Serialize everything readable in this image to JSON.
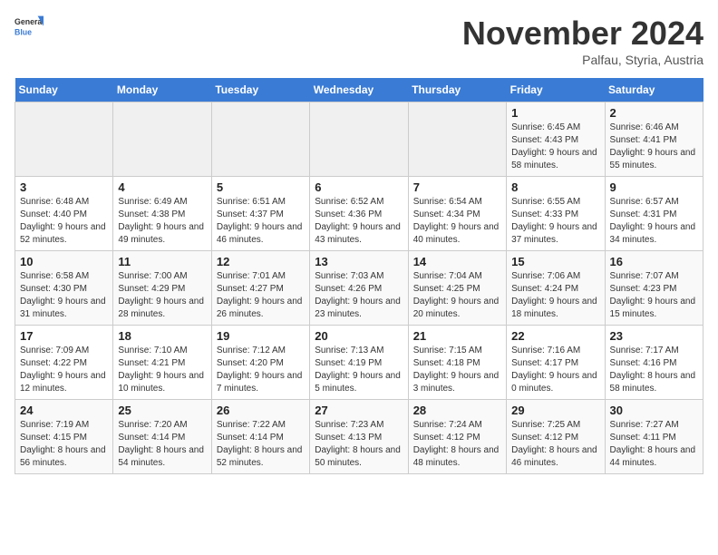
{
  "logo": {
    "line1": "General",
    "line2": "Blue"
  },
  "title": "November 2024",
  "subtitle": "Palfau, Styria, Austria",
  "days_of_week": [
    "Sunday",
    "Monday",
    "Tuesday",
    "Wednesday",
    "Thursday",
    "Friday",
    "Saturday"
  ],
  "weeks": [
    [
      {
        "day": "",
        "info": ""
      },
      {
        "day": "",
        "info": ""
      },
      {
        "day": "",
        "info": ""
      },
      {
        "day": "",
        "info": ""
      },
      {
        "day": "",
        "info": ""
      },
      {
        "day": "1",
        "info": "Sunrise: 6:45 AM\nSunset: 4:43 PM\nDaylight: 9 hours and 58 minutes."
      },
      {
        "day": "2",
        "info": "Sunrise: 6:46 AM\nSunset: 4:41 PM\nDaylight: 9 hours and 55 minutes."
      }
    ],
    [
      {
        "day": "3",
        "info": "Sunrise: 6:48 AM\nSunset: 4:40 PM\nDaylight: 9 hours and 52 minutes."
      },
      {
        "day": "4",
        "info": "Sunrise: 6:49 AM\nSunset: 4:38 PM\nDaylight: 9 hours and 49 minutes."
      },
      {
        "day": "5",
        "info": "Sunrise: 6:51 AM\nSunset: 4:37 PM\nDaylight: 9 hours and 46 minutes."
      },
      {
        "day": "6",
        "info": "Sunrise: 6:52 AM\nSunset: 4:36 PM\nDaylight: 9 hours and 43 minutes."
      },
      {
        "day": "7",
        "info": "Sunrise: 6:54 AM\nSunset: 4:34 PM\nDaylight: 9 hours and 40 minutes."
      },
      {
        "day": "8",
        "info": "Sunrise: 6:55 AM\nSunset: 4:33 PM\nDaylight: 9 hours and 37 minutes."
      },
      {
        "day": "9",
        "info": "Sunrise: 6:57 AM\nSunset: 4:31 PM\nDaylight: 9 hours and 34 minutes."
      }
    ],
    [
      {
        "day": "10",
        "info": "Sunrise: 6:58 AM\nSunset: 4:30 PM\nDaylight: 9 hours and 31 minutes."
      },
      {
        "day": "11",
        "info": "Sunrise: 7:00 AM\nSunset: 4:29 PM\nDaylight: 9 hours and 28 minutes."
      },
      {
        "day": "12",
        "info": "Sunrise: 7:01 AM\nSunset: 4:27 PM\nDaylight: 9 hours and 26 minutes."
      },
      {
        "day": "13",
        "info": "Sunrise: 7:03 AM\nSunset: 4:26 PM\nDaylight: 9 hours and 23 minutes."
      },
      {
        "day": "14",
        "info": "Sunrise: 7:04 AM\nSunset: 4:25 PM\nDaylight: 9 hours and 20 minutes."
      },
      {
        "day": "15",
        "info": "Sunrise: 7:06 AM\nSunset: 4:24 PM\nDaylight: 9 hours and 18 minutes."
      },
      {
        "day": "16",
        "info": "Sunrise: 7:07 AM\nSunset: 4:23 PM\nDaylight: 9 hours and 15 minutes."
      }
    ],
    [
      {
        "day": "17",
        "info": "Sunrise: 7:09 AM\nSunset: 4:22 PM\nDaylight: 9 hours and 12 minutes."
      },
      {
        "day": "18",
        "info": "Sunrise: 7:10 AM\nSunset: 4:21 PM\nDaylight: 9 hours and 10 minutes."
      },
      {
        "day": "19",
        "info": "Sunrise: 7:12 AM\nSunset: 4:20 PM\nDaylight: 9 hours and 7 minutes."
      },
      {
        "day": "20",
        "info": "Sunrise: 7:13 AM\nSunset: 4:19 PM\nDaylight: 9 hours and 5 minutes."
      },
      {
        "day": "21",
        "info": "Sunrise: 7:15 AM\nSunset: 4:18 PM\nDaylight: 9 hours and 3 minutes."
      },
      {
        "day": "22",
        "info": "Sunrise: 7:16 AM\nSunset: 4:17 PM\nDaylight: 9 hours and 0 minutes."
      },
      {
        "day": "23",
        "info": "Sunrise: 7:17 AM\nSunset: 4:16 PM\nDaylight: 8 hours and 58 minutes."
      }
    ],
    [
      {
        "day": "24",
        "info": "Sunrise: 7:19 AM\nSunset: 4:15 PM\nDaylight: 8 hours and 56 minutes."
      },
      {
        "day": "25",
        "info": "Sunrise: 7:20 AM\nSunset: 4:14 PM\nDaylight: 8 hours and 54 minutes."
      },
      {
        "day": "26",
        "info": "Sunrise: 7:22 AM\nSunset: 4:14 PM\nDaylight: 8 hours and 52 minutes."
      },
      {
        "day": "27",
        "info": "Sunrise: 7:23 AM\nSunset: 4:13 PM\nDaylight: 8 hours and 50 minutes."
      },
      {
        "day": "28",
        "info": "Sunrise: 7:24 AM\nSunset: 4:12 PM\nDaylight: 8 hours and 48 minutes."
      },
      {
        "day": "29",
        "info": "Sunrise: 7:25 AM\nSunset: 4:12 PM\nDaylight: 8 hours and 46 minutes."
      },
      {
        "day": "30",
        "info": "Sunrise: 7:27 AM\nSunset: 4:11 PM\nDaylight: 8 hours and 44 minutes."
      }
    ]
  ]
}
